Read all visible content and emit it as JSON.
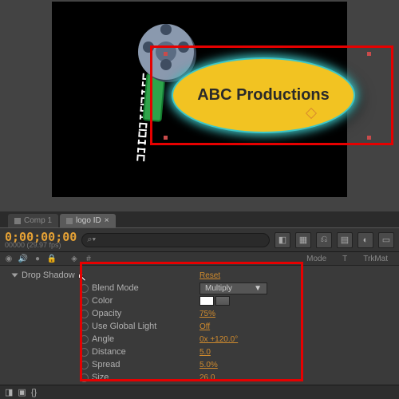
{
  "preview": {
    "logo_text": "ABC Productions"
  },
  "tabs": [
    {
      "label": "Comp 1",
      "active": false
    },
    {
      "label": "logo ID",
      "active": true
    }
  ],
  "toolbar": {
    "timecode": "0;00;00;00",
    "frame_info": "00000 (29.97 fps)",
    "search_placeholder": "⌕▾"
  },
  "columns": {
    "mode": "Mode",
    "t": "T",
    "trkmat": "TrkMat"
  },
  "effect": {
    "name": "Drop Shadow",
    "reset": "Reset",
    "props": [
      {
        "label": "Blend Mode",
        "type": "dropdown",
        "value": "Multiply"
      },
      {
        "label": "Color",
        "type": "color",
        "value": "#ffffff"
      },
      {
        "label": "Opacity",
        "type": "link",
        "value": "75%"
      },
      {
        "label": "Use Global Light",
        "type": "link",
        "value": "Off"
      },
      {
        "label": "Angle",
        "type": "link",
        "value": "0x +120.0°"
      },
      {
        "label": "Distance",
        "type": "link",
        "value": "5.0"
      },
      {
        "label": "Spread",
        "type": "link",
        "value": "5.0%"
      },
      {
        "label": "Size",
        "type": "link",
        "value": "26.0"
      }
    ]
  }
}
